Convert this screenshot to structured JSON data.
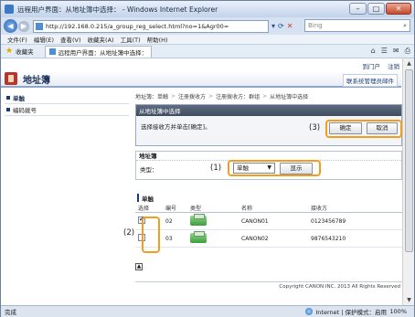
{
  "browser": {
    "title": "远程用户界面：从地址簿中选择： - Windows Internet Explorer",
    "url": "http://192.168.0.215/a_group_reg_select.html?no=1&Agr00=",
    "search_placeholder": "Bing",
    "menu": [
      "文件(F)",
      "编辑(E)",
      "查看(V)",
      "收藏夹(A)",
      "工具(T)",
      "帮助(H)"
    ],
    "favorites_label": "收藏夹",
    "tab_label": "远程用户界面：从地址簿中选择：",
    "status_left": "完成",
    "status_zone": "Internet | 保护模式：启用",
    "zoom": "100%"
  },
  "page": {
    "top_links": [
      "到门户",
      "注销"
    ],
    "title": "地址簿",
    "header_link": "联系统管理员邮件",
    "sidebar": [
      {
        "label": "单触",
        "active": true
      },
      {
        "label": "编码拨号",
        "active": false
      }
    ],
    "breadcrumb": [
      "地址簿：单触",
      "注册拨收方",
      "注册拨收方：群组",
      "从地址簿中选择"
    ],
    "panel_title": "从地址簿中选择",
    "instruction": "选择接收方并单击[确定]。",
    "ok_label": "确定",
    "cancel_label": "取消",
    "section_addressbook": "地址簿",
    "type_label": "类型：",
    "select_value": "单触",
    "display_label": "显示",
    "list_title": "单触",
    "columns": [
      "选择",
      "编号",
      "类型",
      "名称",
      "接收方"
    ],
    "rows": [
      {
        "checked": true,
        "no": "02",
        "name": "CANON01",
        "dest": "0123456789"
      },
      {
        "checked": false,
        "no": "03",
        "name": "CANON02",
        "dest": "9876543210"
      }
    ],
    "footer": "Copyright CANON INC. 2013 All Rights Reserved",
    "callouts": [
      "(3)",
      "(1)",
      "(2)"
    ]
  }
}
